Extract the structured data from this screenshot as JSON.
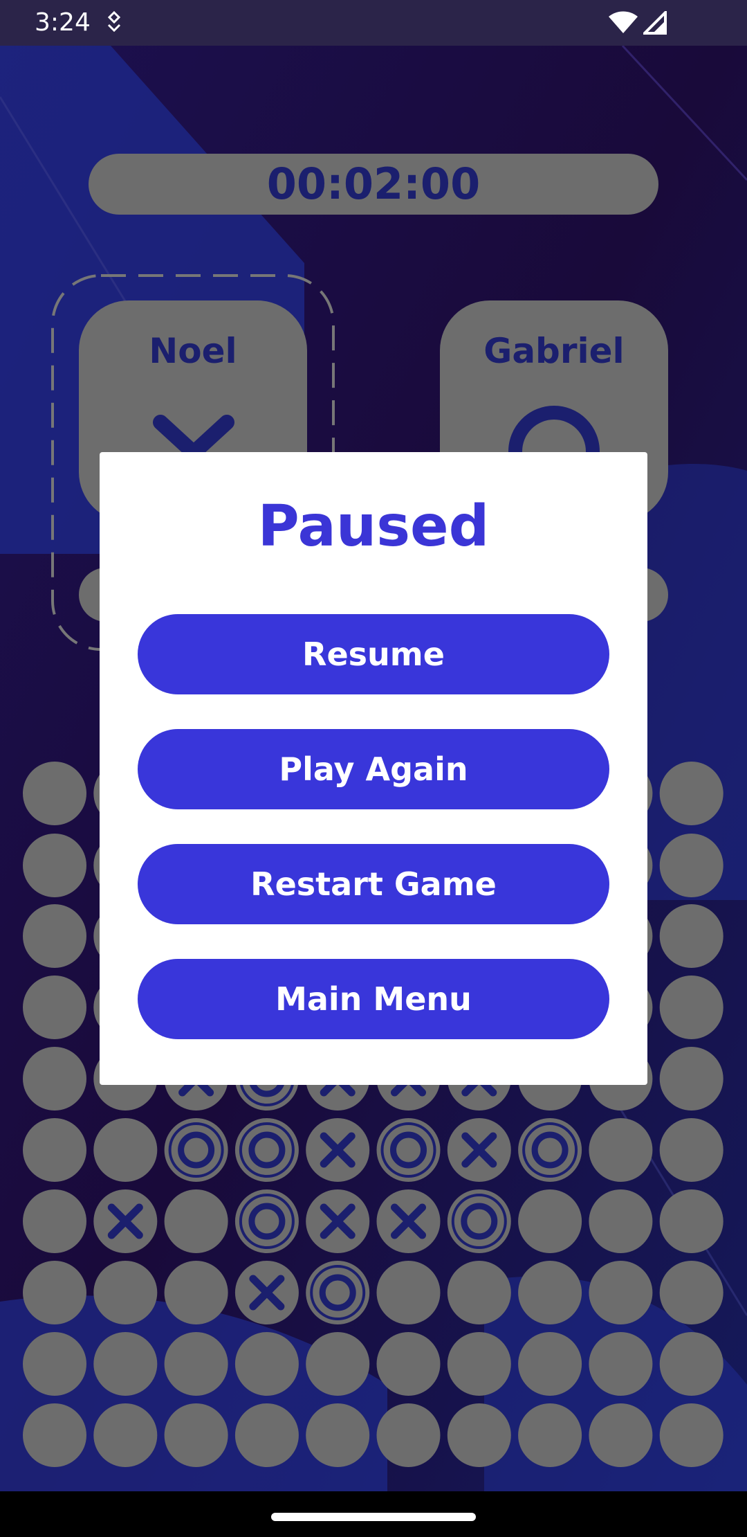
{
  "status_bar": {
    "time": "3:24",
    "icons": [
      "notification-icon",
      "wifi-icon",
      "signal-icon"
    ]
  },
  "game": {
    "timer": "00:02:00",
    "players": [
      {
        "name": "Noel",
        "symbol": "X",
        "active": true
      },
      {
        "name": "Gabriel",
        "symbol": "O",
        "active": false
      }
    ],
    "board_visible_rows": [
      [
        "",
        "",
        "X",
        "O",
        "X",
        "X",
        "X",
        "",
        "",
        ""
      ],
      [
        "",
        "",
        "O",
        "O",
        "X",
        "O",
        "X",
        "O",
        "",
        ""
      ],
      [
        "",
        "X",
        "",
        "O",
        "X",
        "X",
        "O",
        "",
        "",
        ""
      ],
      [
        "",
        "",
        "",
        "X",
        "O",
        "",
        "",
        "",
        "",
        ""
      ],
      [
        "",
        "",
        "",
        "",
        "",
        "",
        "",
        "",
        "",
        ""
      ],
      [
        "",
        "",
        "",
        "",
        "",
        "",
        "",
        "",
        "",
        ""
      ]
    ]
  },
  "pause_dialog": {
    "title": "Paused",
    "buttons": {
      "resume": "Resume",
      "play_again": "Play Again",
      "restart": "Restart Game",
      "main_menu": "Main Menu"
    }
  },
  "colors": {
    "accent": "#3936da",
    "title": "#3b35d6",
    "cell": "#6d6d6d",
    "mark": "#1b1f6e",
    "background": "#160b36"
  }
}
